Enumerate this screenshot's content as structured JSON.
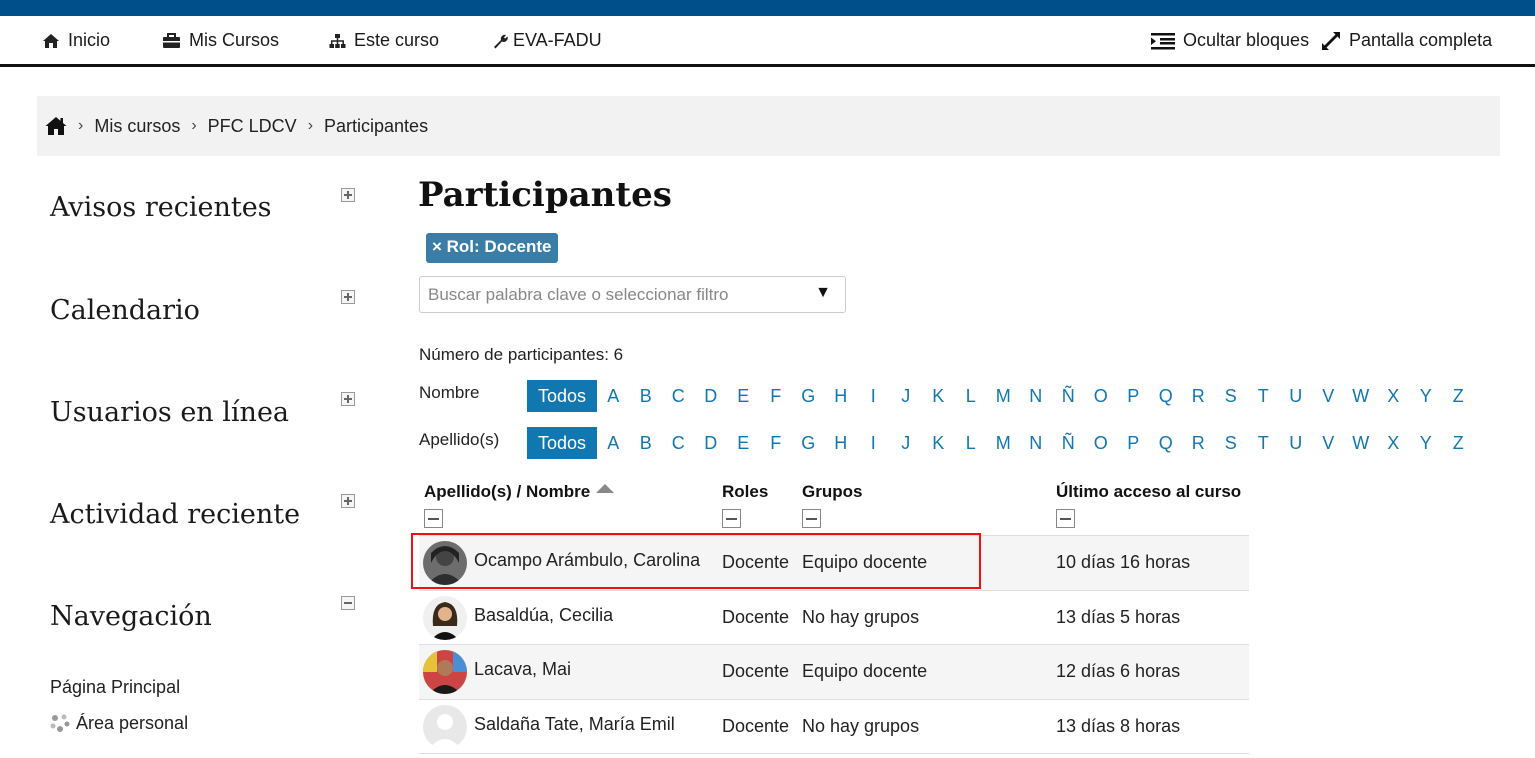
{
  "navbar": {
    "home": "Inicio",
    "my_courses": "Mis Cursos",
    "this_course": "Este curso",
    "site": "EVA-FADU",
    "hide_blocks": "Ocultar bloques",
    "fullscreen": "Pantalla completa"
  },
  "breadcrumb": {
    "items": [
      "Mis cursos",
      "PFC LDCV",
      "Participantes"
    ],
    "separator": "›"
  },
  "blocks": [
    {
      "title": "Avisos recientes",
      "state": "collapsed"
    },
    {
      "title": "Calendario",
      "state": "collapsed"
    },
    {
      "title": "Usuarios en línea",
      "state": "collapsed"
    },
    {
      "title": "Actividad reciente",
      "state": "collapsed"
    },
    {
      "title": "Navegación",
      "state": "expanded"
    }
  ],
  "navigation": {
    "items": [
      "Página Principal",
      "Área personal"
    ]
  },
  "main": {
    "title": "Participantes",
    "active_filter": "× Rol: Docente",
    "search_placeholder": "Buscar palabra clave o seleccionar filtro",
    "count_text": "Número de participantes: 6"
  },
  "initials": {
    "first_name_label": "Nombre",
    "last_name_label": "Apellido(s)",
    "all_label": "Todos",
    "letters": [
      "A",
      "B",
      "C",
      "D",
      "E",
      "F",
      "G",
      "H",
      "I",
      "J",
      "K",
      "L",
      "M",
      "N",
      "Ñ",
      "O",
      "P",
      "Q",
      "R",
      "S",
      "T",
      "U",
      "V",
      "W",
      "X",
      "Y",
      "Z"
    ]
  },
  "table": {
    "headers": {
      "name": "Apellido(s) / Nombre",
      "roles": "Roles",
      "groups": "Grupos",
      "last_access": "Último acceso al curso"
    },
    "sorted_by": "name",
    "rows": [
      {
        "name": "Ocampo Arámbulo, Carolina",
        "role": "Docente",
        "group": "Equipo docente",
        "last_access": "10 días 16 horas",
        "highlighted": true
      },
      {
        "name": "Basaldúa, Cecilia",
        "role": "Docente",
        "group": "No hay grupos",
        "last_access": "13 días 5 horas",
        "highlighted": false
      },
      {
        "name": "Lacava, Mai",
        "role": "Docente",
        "group": "Equipo docente",
        "last_access": "12 días 6 horas",
        "highlighted": false
      },
      {
        "name": "Saldaña Tate, María Emil",
        "role": "Docente",
        "group": "No hay grupos",
        "last_access": "13 días 8 horas",
        "highlighted": false
      }
    ]
  },
  "colors": {
    "top_stripe": "#004f8a",
    "link_blue": "#1177b0",
    "chip_blue": "#3a7ea8",
    "highlight_red": "#ee1111"
  }
}
